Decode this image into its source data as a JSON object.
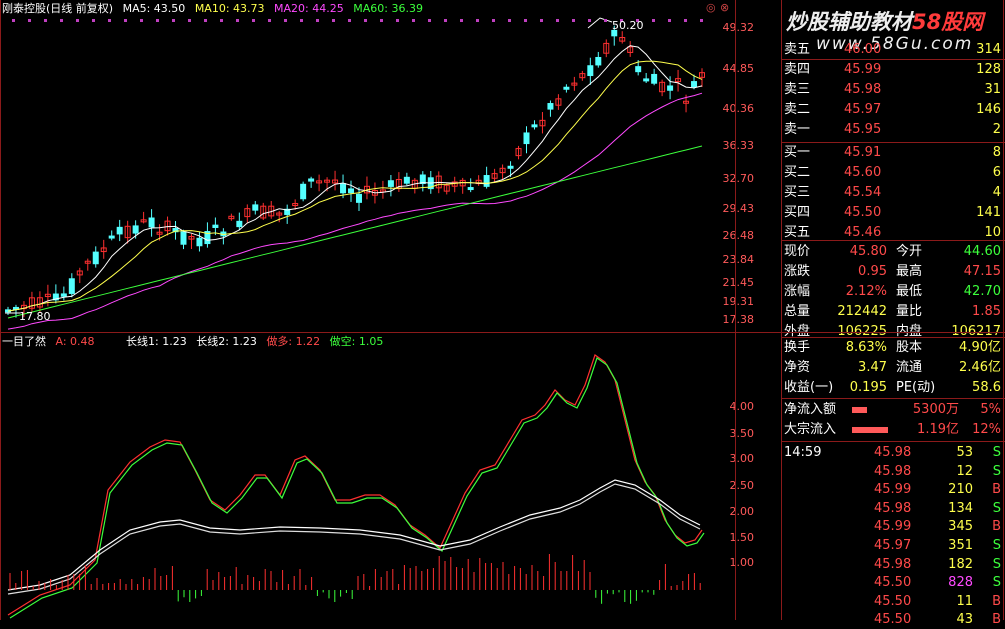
{
  "header": {
    "stock_name": "刚泰控股(日线 前复权)",
    "ma5": "MA5: 43.50",
    "ma10": "MA10: 43.73",
    "ma20": "MA20: 44.25",
    "ma60": "MA60: 36.39"
  },
  "colors": {
    "up": "#ff3030",
    "down": "#54ffff",
    "ma5": "#ffffff",
    "ma10": "#ffff4d",
    "ma20": "#ff4aff",
    "ma60": "#3cff3c",
    "grid": "#8b1a1a"
  },
  "annotations": {
    "high_label": "50.20",
    "low_label": "17.80"
  },
  "price_axis": [
    "49.32",
    "44.85",
    "40.36",
    "36.33",
    "32.70",
    "29.43",
    "26.48",
    "23.84",
    "21.45",
    "19.31",
    "17.38"
  ],
  "indicator": {
    "name": "一目了然",
    "a_label": "A: 0.48",
    "long1": "长线1: 1.23",
    "long2": "长线2: 1.23",
    "bull": "做多: 1.22",
    "bear": "做空: 1.05",
    "axis": [
      "4.00",
      "3.50",
      "3.00",
      "2.50",
      "2.00",
      "1.50",
      "1.00"
    ]
  },
  "watermark": {
    "part1": "炒股辅助教材",
    "part2": "58股网",
    "url": "www.58Gu.com"
  },
  "window_buttons": [
    "◎",
    "⊗"
  ],
  "order_book": {
    "sell": [
      {
        "label": "卖五",
        "price": "46.00",
        "vol": "314"
      },
      {
        "label": "卖四",
        "price": "45.99",
        "vol": "128"
      },
      {
        "label": "卖三",
        "price": "45.98",
        "vol": "31"
      },
      {
        "label": "卖二",
        "price": "45.97",
        "vol": "146"
      },
      {
        "label": "卖一",
        "price": "45.95",
        "vol": "2"
      }
    ],
    "buy": [
      {
        "label": "买一",
        "price": "45.91",
        "vol": "8"
      },
      {
        "label": "买二",
        "price": "45.60",
        "vol": "6"
      },
      {
        "label": "买三",
        "price": "45.54",
        "vol": "4"
      },
      {
        "label": "买四",
        "price": "45.50",
        "vol": "141"
      },
      {
        "label": "买五",
        "price": "45.46",
        "vol": "10"
      }
    ]
  },
  "quote": [
    {
      "l1": "现价",
      "v1": "45.80",
      "l2": "今开",
      "v2": "44.60"
    },
    {
      "l1": "涨跌",
      "v1": "0.95",
      "l2": "最高",
      "v2": "47.15"
    },
    {
      "l1": "涨幅",
      "v1": "2.12%",
      "l2": "最低",
      "v2": "42.70"
    },
    {
      "l1": "总量",
      "v1": "212442",
      "l2": "量比",
      "v2": "1.85"
    },
    {
      "l1": "外盘",
      "v1": "106225",
      "l2": "内盘",
      "v2": "106217"
    }
  ],
  "stats": [
    {
      "l1": "换手",
      "v1": "8.63%",
      "l2": "股本",
      "v2": "4.90亿"
    },
    {
      "l1": "净资",
      "v1": "3.47",
      "l2": "流通",
      "v2": "2.46亿"
    },
    {
      "l1": "收益(一)",
      "v1": "0.195",
      "l2": "PE(动)",
      "v2": "58.6"
    }
  ],
  "flow": [
    {
      "label": "净流入额",
      "value": "5300万",
      "pct": "5%",
      "bar": 0.05
    },
    {
      "label": "大宗流入",
      "value": "1.19亿",
      "pct": "12%",
      "bar": 0.12
    }
  ],
  "ticks": [
    {
      "time": "14:59",
      "price": "45.98",
      "vol": "53",
      "side": "S"
    },
    {
      "time": "",
      "price": "45.98",
      "vol": "12",
      "side": "S"
    },
    {
      "time": "",
      "price": "45.99",
      "vol": "210",
      "side": "B"
    },
    {
      "time": "",
      "price": "45.98",
      "vol": "134",
      "side": "S"
    },
    {
      "time": "",
      "price": "45.99",
      "vol": "345",
      "side": "B"
    },
    {
      "time": "",
      "price": "45.97",
      "vol": "351",
      "side": "S"
    },
    {
      "time": "",
      "price": "45.98",
      "vol": "182",
      "side": "S"
    },
    {
      "time": "",
      "price": "45.50",
      "vol": "828",
      "side": "S"
    },
    {
      "time": "",
      "price": "45.50",
      "vol": "11",
      "side": "B"
    },
    {
      "time": "",
      "price": "45.50",
      "vol": "43",
      "side": "B"
    }
  ]
}
